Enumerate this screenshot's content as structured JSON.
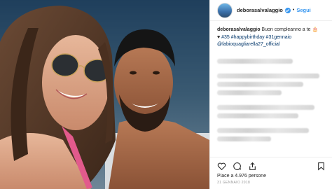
{
  "post": {
    "username": "deborasalvalaggio",
    "follow_label": "Segui",
    "separator": "•",
    "caption_text": "Buon compleanno a te",
    "caption_line2_hashtags": "#35 #happybirthday #31gennaio",
    "caption_mention": "@fabioquagliarella27_official",
    "likes_text": "Piace a 4.976 persone",
    "date_text": "31 GENNAIO 2018"
  },
  "colors": {
    "accent": "#3897f0",
    "text": "#262626",
    "link": "#003569",
    "muted": "#999999"
  },
  "icons": [
    "verified-badge",
    "heart-icon",
    "comment-icon",
    "share-icon",
    "bookmark-icon"
  ]
}
